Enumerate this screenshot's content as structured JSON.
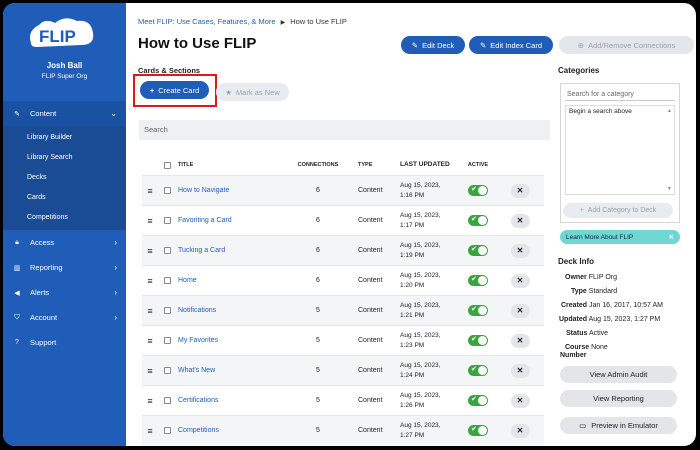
{
  "sidebar": {
    "user_name": "Josh Ball",
    "user_org": "FLIP Super Org",
    "items": [
      {
        "label": "Content",
        "icon": "edit-icon",
        "chevron": "⌄"
      },
      {
        "label": "Access",
        "icon": "lock-icon",
        "chevron": "›"
      },
      {
        "label": "Reporting",
        "icon": "chart-icon",
        "chevron": "›"
      },
      {
        "label": "Alerts",
        "icon": "megaphone-icon",
        "chevron": "›"
      },
      {
        "label": "Account",
        "icon": "shield-icon",
        "chevron": "›"
      },
      {
        "label": "Support",
        "icon": "help-icon",
        "chevron": ""
      }
    ],
    "subitems": [
      "Library Builder",
      "Library Search",
      "Decks",
      "Cards",
      "Competitions"
    ]
  },
  "header": {
    "breadcrumb_parent": "Meet FLIP: Use Cases, Features, & More",
    "breadcrumb_current": "How to Use FLIP",
    "title": "How to Use FLIP",
    "edit_deck": "Edit Deck",
    "edit_index_card": "Edit Index Card",
    "add_remove_connections": "Add/Remove Connections"
  },
  "cards": {
    "section_label": "Cards & Sections",
    "create_card": "Create Card",
    "mark_as_new": "Mark as New",
    "search_placeholder": "Search",
    "columns": {
      "title": "TITLE",
      "connections": "CONNECTIONS",
      "type": "TYPE",
      "last_updated": "LAST UPDATED",
      "active": "ACTIVE"
    },
    "rows": [
      {
        "title": "How to Navigate",
        "connections": "6",
        "type": "Content",
        "date": "Aug 15, 2023,",
        "time": "1:16 PM"
      },
      {
        "title": "Favoriting a Card",
        "connections": "6",
        "type": "Content",
        "date": "Aug 15, 2023,",
        "time": "1:17 PM"
      },
      {
        "title": "Tucking a Card",
        "connections": "6",
        "type": "Content",
        "date": "Aug 15, 2023,",
        "time": "1:19 PM"
      },
      {
        "title": "Home",
        "connections": "6",
        "type": "Content",
        "date": "Aug 15, 2023,",
        "time": "1:20 PM"
      },
      {
        "title": "Notifications",
        "connections": "5",
        "type": "Content",
        "date": "Aug 15, 2023,",
        "time": "1:21 PM"
      },
      {
        "title": "My Favorites",
        "connections": "5",
        "type": "Content",
        "date": "Aug 15, 2023,",
        "time": "1:23 PM"
      },
      {
        "title": "What's New",
        "connections": "5",
        "type": "Content",
        "date": "Aug 15, 2023,",
        "time": "1:24 PM"
      },
      {
        "title": "Certifications",
        "connections": "5",
        "type": "Content",
        "date": "Aug 15, 2023,",
        "time": "1:26 PM"
      },
      {
        "title": "Competitions",
        "connections": "5",
        "type": "Content",
        "date": "Aug 15, 2023,",
        "time": "1:27 PM"
      }
    ]
  },
  "categories": {
    "heading": "Categories",
    "search_placeholder": "Search for a category",
    "hint": "Begin a search above",
    "add_button": "Add Category to Deck",
    "learn_more": "Learn More About FLIP"
  },
  "deck_info": {
    "heading": "Deck Info",
    "owner_label": "Owner",
    "owner": "FLIP Org",
    "type_label": "Type",
    "type": "Standard",
    "created_label": "Created",
    "created": "Jan 16, 2017, 10:57 AM",
    "updated_label": "Updated",
    "updated": "Aug 15, 2023, 1:27 PM",
    "status_label": "Status",
    "status": "Active",
    "course_label": "Course",
    "course_label2": "Number",
    "course": "None",
    "view_admin_audit": "View Admin Audit",
    "view_reporting": "View Reporting",
    "preview_emulator": "Preview in Emulator"
  },
  "colors": {
    "brand": "#1f5db8",
    "active_toggle": "#3aa53f",
    "highlight": "#e0181b",
    "learn_more_bg": "#6fd6d1"
  }
}
